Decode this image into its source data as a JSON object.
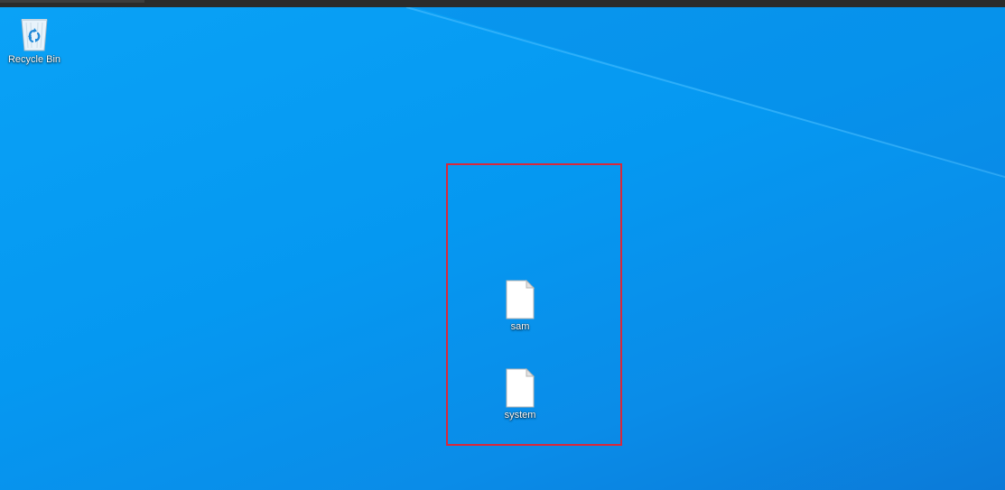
{
  "desktop": {
    "background_color": "#0598f1",
    "icons": [
      {
        "label": "Recycle Bin",
        "icon": "recycle-bin-icon"
      },
      {
        "label": "sam",
        "icon": "file-icon"
      },
      {
        "label": "system",
        "icon": "file-icon"
      }
    ]
  },
  "annotation": {
    "highlight_color": "#d9283a"
  }
}
